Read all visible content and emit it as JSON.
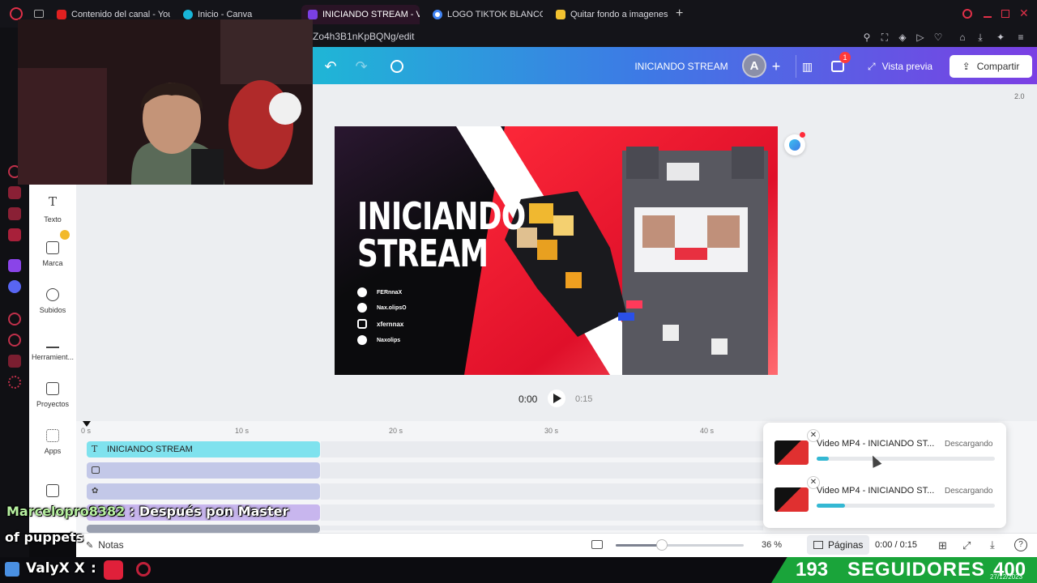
{
  "browser": {
    "tabs": [
      {
        "label": "Contenido del canal - YouT",
        "icon": "youtube-icon",
        "color": "#e02020"
      },
      {
        "label": "Inicio - Canva",
        "icon": "canva-icon",
        "color": "#18b6d9"
      },
      {
        "label": "INICIANDO STREAM - Víde",
        "icon": "canva-video-icon",
        "color": "#7b3fe4"
      },
      {
        "label": "LOGO TIKTOK BLANCO - (",
        "icon": "google-icon",
        "color": "#4285f4"
      },
      {
        "label": "Quitar fondo a imagenes o",
        "icon": "removebg-icon",
        "color": "#f2c230"
      }
    ],
    "new_tab": "+",
    "url": "Zo4h3B1nKpBQNg/edit"
  },
  "canva": {
    "header": {
      "title": "INICIANDO STREAM",
      "avatar_letter": "A",
      "comments_badge": "1",
      "preview_label": "Vista previa",
      "share_label": "Compartir"
    },
    "zoom_corner": "2.0",
    "left_panel": [
      {
        "label": "Texto",
        "icon": "text-icon"
      },
      {
        "label": "Marca",
        "icon": "brand-icon"
      },
      {
        "label": "Subidos",
        "icon": "upload-icon"
      },
      {
        "label": "Herramient...",
        "icon": "tools-icon"
      },
      {
        "label": "Proyectos",
        "icon": "folder-icon"
      },
      {
        "label": "Apps",
        "icon": "apps-icon"
      }
    ],
    "design": {
      "headline_line1": "INICIANDO",
      "headline_line2": "STREAM",
      "socials": [
        {
          "icon": "tiktok-icon",
          "handle": "FERnnaX"
        },
        {
          "icon": "tiktok-icon",
          "handle": "Nax.olipsO"
        },
        {
          "icon": "instagram-icon",
          "handle": "xfernnax"
        },
        {
          "icon": "facebook-icon",
          "handle": "Naxolips"
        }
      ]
    },
    "playback": {
      "current": "0:00",
      "total": "0:15"
    },
    "timeline": {
      "ticks": [
        "0 s",
        "10 s",
        "20 s",
        "30 s",
        "40 s"
      ],
      "text_track": "INICIANDO STREAM"
    },
    "bottom": {
      "notes_label": "Notas",
      "zoom": "36 %",
      "zoom_fraction": 0.36,
      "pages_label": "Páginas",
      "time": "0:00 / 0:15"
    },
    "downloads": [
      {
        "title": "Video MP4 - INICIANDO ST...",
        "status": "Descargando",
        "progress": 0.07
      },
      {
        "title": "Video MP4 - INICIANDO ST...",
        "status": "Descargando",
        "progress": 0.16
      }
    ]
  },
  "stream": {
    "chat_user": "Marcelopro8382",
    "chat_message": ": Después pon Master",
    "chat_message_2": "of puppets",
    "bottom_user": "ValyX X",
    "followers_count": "193",
    "followers_label": "SEGUIDORES",
    "followers_goal": "400",
    "date": "27/12/2023"
  }
}
